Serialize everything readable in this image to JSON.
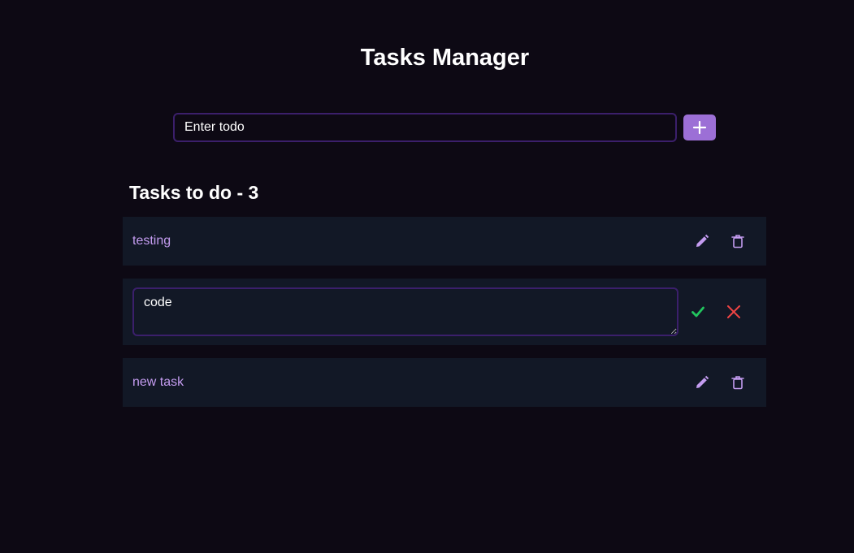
{
  "header": {
    "title": "Tasks Manager"
  },
  "add_form": {
    "input_value": "Enter todo",
    "add_icon": "plus-icon"
  },
  "tasks_section": {
    "heading": "Tasks to do - 3"
  },
  "tasks": [
    {
      "text": "testing",
      "mode": "view",
      "actions": [
        "pencil-icon",
        "trash-icon"
      ]
    },
    {
      "text": "code",
      "mode": "editing",
      "actions": [
        "check-icon",
        "close-icon"
      ]
    },
    {
      "text": "new task",
      "mode": "view",
      "actions": [
        "pencil-icon",
        "trash-icon"
      ]
    }
  ],
  "colors": {
    "background": "#0d0914",
    "card": "#121826",
    "accent": "#9c6fd6",
    "task_text": "#c49cf0",
    "border": "#3b1f6b",
    "confirm": "#22c55e",
    "cancel": "#ef4444"
  }
}
